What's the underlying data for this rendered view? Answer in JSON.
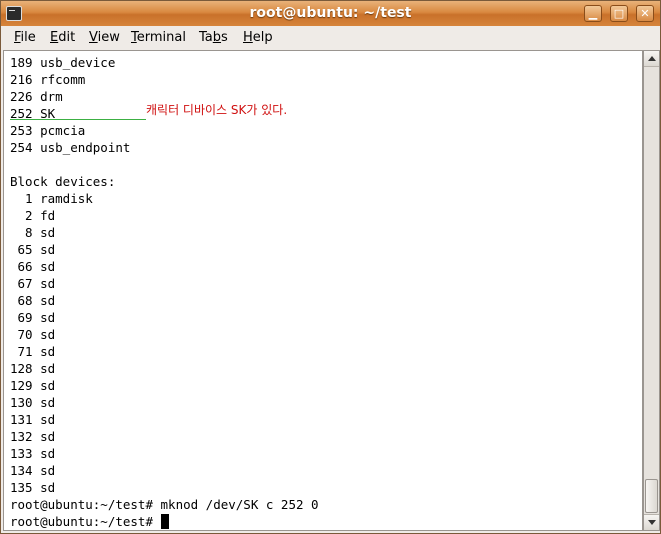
{
  "window": {
    "title": "root@ubuntu: ~/test",
    "controls": {
      "minimize": "▁",
      "maximize": "□",
      "close": "✕"
    }
  },
  "menu": {
    "items": [
      {
        "label": "File",
        "u": "F",
        "rest": "ile"
      },
      {
        "label": "Edit",
        "u": "E",
        "rest": "dit"
      },
      {
        "label": "View",
        "u": "V",
        "rest": "iew"
      },
      {
        "label": "Terminal",
        "u": "T",
        "rest": "erminal"
      },
      {
        "label": "Tabs",
        "pre": "Ta",
        "u": "b",
        "rest": "s"
      },
      {
        "label": "Help",
        "u": "H",
        "rest": "elp"
      }
    ]
  },
  "terminal": {
    "lines": [
      "189 usb_device",
      "216 rfcomm",
      "226 drm",
      "252 SK",
      "253 pcmcia",
      "254 usb_endpoint",
      "",
      "Block devices:",
      "  1 ramdisk",
      "  2 fd",
      "  8 sd",
      " 65 sd",
      " 66 sd",
      " 67 sd",
      " 68 sd",
      " 69 sd",
      " 70 sd",
      " 71 sd",
      "128 sd",
      "129 sd",
      "130 sd",
      "131 sd",
      "132 sd",
      "133 sd",
      "134 sd",
      "135 sd",
      "root@ubuntu:~/test# mknod /dev/SK c 252 0"
    ],
    "prompt": "root@ubuntu:~/test# "
  },
  "annotation": {
    "text": "캐릭터 디바이스 SK가 있다."
  },
  "colors": {
    "titlebar": "#d98940",
    "annotation": "#d01010",
    "underline": "#3cb043"
  }
}
